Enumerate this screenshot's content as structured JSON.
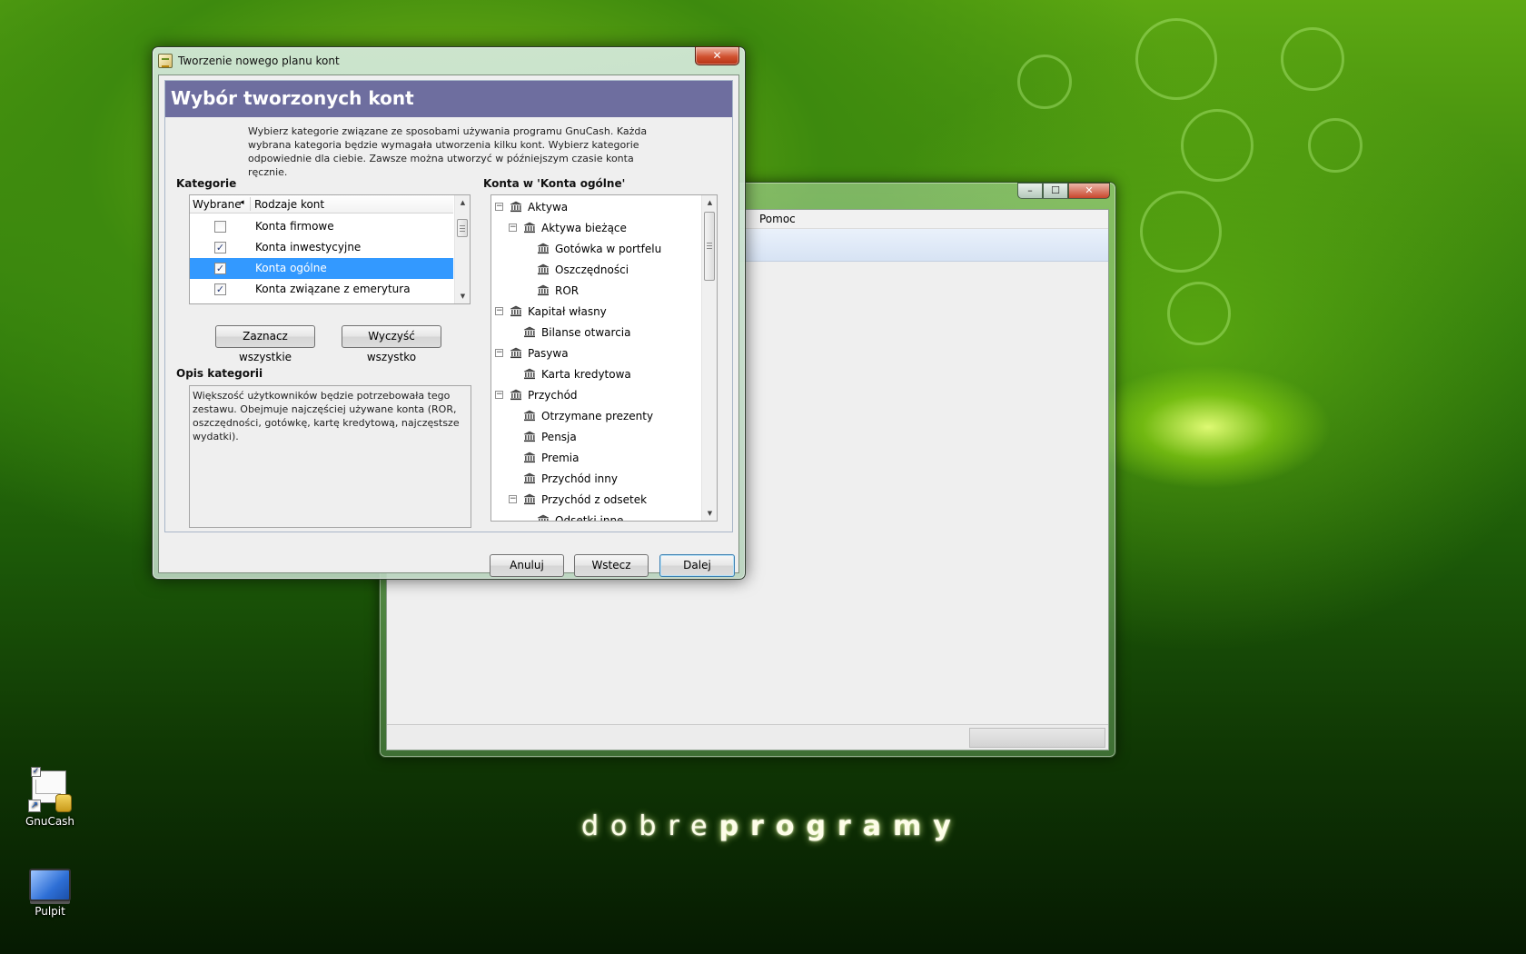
{
  "background_window": {
    "menu_help": "Pomoc",
    "window_buttons": {
      "minimize": "–",
      "maximize": "☐",
      "close": "✕"
    }
  },
  "dialog": {
    "title": "Tworzenie nowego planu kont",
    "close_glyph": "✕",
    "header": "Wybór tworzonych kont",
    "intro": "Wybierz kategorie związane ze sposobami używania programu GnuCash. Każda wybrana kategoria będzie wymagała utworzenia kilku kont. Wybierz kategorie odpowiednie dla ciebie. Zawsze można utworzyć w późniejszym czasie konta ręcznie.",
    "categories_label": "Kategorie",
    "accounts_label": "Konta w 'Konta ogólne'",
    "columns": {
      "selected": "Wybrane",
      "sort_indicator": "◂",
      "types": "Rodzaje kont"
    },
    "categories": [
      {
        "label": "Konta firmowe",
        "checked": false,
        "selected": false,
        "mark": ""
      },
      {
        "label": "Konta inwestycyjne",
        "checked": true,
        "selected": false,
        "mark": "✓"
      },
      {
        "label": "Konta ogólne",
        "checked": true,
        "selected": true,
        "mark": "✓"
      },
      {
        "label": "Konta związane z emerytura",
        "checked": true,
        "selected": false,
        "mark": "✓"
      }
    ],
    "select_all": "Zaznacz wszystkie",
    "clear_all": "Wyczyść wszystko",
    "description_label": "Opis kategorii",
    "description": "Większość użytkowników będzie potrzebowała tego zestawu. Obejmuje najczęściej używane konta (ROR, oszczędności, gotówkę, kartę kredytową, najczęstsze wydatki).",
    "tree": [
      {
        "label": "Aktywa",
        "level": 0,
        "expander": "−"
      },
      {
        "label": "Aktywa bieżące",
        "level": 1,
        "expander": "−"
      },
      {
        "label": "Gotówka w portfelu",
        "level": 2,
        "expander": ""
      },
      {
        "label": "Oszczędności",
        "level": 2,
        "expander": ""
      },
      {
        "label": "ROR",
        "level": 2,
        "expander": ""
      },
      {
        "label": "Kapitał własny",
        "level": 0,
        "expander": "−"
      },
      {
        "label": "Bilanse otwarcia",
        "level": 1,
        "expander": ""
      },
      {
        "label": "Pasywa",
        "level": 0,
        "expander": "−"
      },
      {
        "label": "Karta kredytowa",
        "level": 1,
        "expander": ""
      },
      {
        "label": "Przychód",
        "level": 0,
        "expander": "−"
      },
      {
        "label": "Otrzymane prezenty",
        "level": 1,
        "expander": ""
      },
      {
        "label": "Pensja",
        "level": 1,
        "expander": ""
      },
      {
        "label": "Premia",
        "level": 1,
        "expander": ""
      },
      {
        "label": "Przychód inny",
        "level": 1,
        "expander": ""
      },
      {
        "label": "Przychód z odsetek",
        "level": 1,
        "expander": "−"
      },
      {
        "label": "Odsetki inne",
        "level": 2,
        "expander": ""
      }
    ],
    "buttons": {
      "cancel": "Anuluj",
      "back": "Wstecz",
      "next": "Dalej"
    }
  },
  "desktop": {
    "icons": [
      {
        "label": "GnuCash"
      },
      {
        "label": "Pulpit"
      }
    ],
    "brand_light": "dobre",
    "brand_bold": "programy"
  },
  "colors": {
    "header_band": "#6e6e9f",
    "selection": "#3399ff",
    "close_button": "#c8452c"
  },
  "icons": {
    "tree_account": "bank-icon",
    "dialog_title": "gnucash-app-icon",
    "desktop_gnucash": "gnucash-icon",
    "desktop_pulpit": "monitor-icon"
  }
}
